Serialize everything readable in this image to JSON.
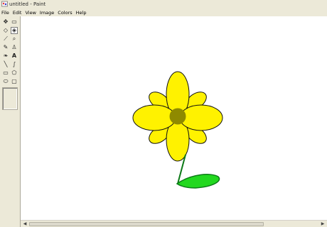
{
  "window": {
    "title": "untitled - Paint"
  },
  "menu": {
    "items": [
      {
        "label": "File"
      },
      {
        "label": "Edit"
      },
      {
        "label": "View"
      },
      {
        "label": "Image"
      },
      {
        "label": "Colors"
      },
      {
        "label": "Help"
      }
    ]
  },
  "toolbox": {
    "tools": [
      {
        "name": "free-form-select-icon",
        "glyph": "✥"
      },
      {
        "name": "select-icon",
        "glyph": "▭"
      },
      {
        "name": "eraser-icon",
        "glyph": "◇"
      },
      {
        "name": "fill-with-color-icon",
        "glyph": "◈"
      },
      {
        "name": "pick-color-icon",
        "glyph": "⟋"
      },
      {
        "name": "magnifier-icon",
        "glyph": "⌕"
      },
      {
        "name": "pencil-icon",
        "glyph": "✎"
      },
      {
        "name": "brush-icon",
        "glyph": "♙"
      },
      {
        "name": "airbrush-icon",
        "glyph": "❧"
      },
      {
        "name": "text-icon",
        "glyph": "A"
      },
      {
        "name": "line-icon",
        "glyph": "╲"
      },
      {
        "name": "curve-icon",
        "glyph": "∫"
      },
      {
        "name": "rectangle-icon",
        "glyph": "▭"
      },
      {
        "name": "polygon-icon",
        "glyph": "⬠"
      },
      {
        "name": "ellipse-icon",
        "glyph": "⬭"
      },
      {
        "name": "rounded-rectangle-icon",
        "glyph": "▢"
      }
    ],
    "active_tool": "fill-with-color-icon"
  },
  "canvas": {
    "drawing": "flower",
    "colors": {
      "petal": "#fff200",
      "center": "#8f8a00",
      "leaf": "#22d81f",
      "stem": "#0d7a18",
      "outline": "#111111",
      "background": "#ffffff"
    }
  }
}
